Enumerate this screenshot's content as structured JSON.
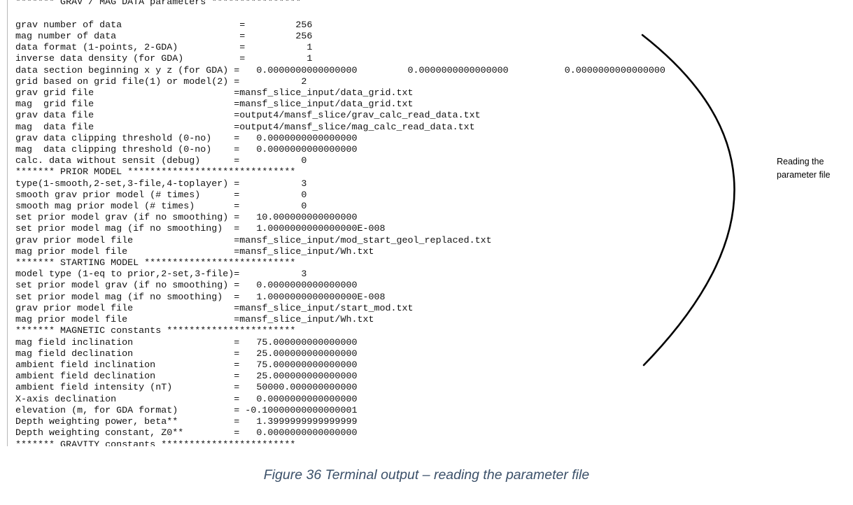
{
  "terminal": {
    "lines": [
      "******* GRAV / MAG DATA parameters ****************",
      "grav number of data                     =         256",
      "mag number of data                      =         256",
      "data format (1-points, 2-GDA)           =           1",
      "inverse data density (for GDA)          =           1",
      "data section beginning x y z (for GDA) =   0.0000000000000000         0.0000000000000000          0.0000000000000000",
      "grid based on grid file(1) or model(2) =           2",
      "grav grid file                         =mansf_slice_input/data_grid.txt",
      "mag  grid file                         =mansf_slice_input/data_grid.txt",
      "grav data file                         =output4/mansf_slice/grav_calc_read_data.txt",
      "mag  data file                         =output4/mansf_slice/mag_calc_read_data.txt",
      "grav data clipping threshold (0-no)    =   0.0000000000000000",
      "mag  data clipping threshold (0-no)    =   0.0000000000000000",
      "calc. data without sensit (debug)      =           0",
      "******* PRIOR MODEL ******************************",
      "type(1-smooth,2-set,3-file,4-toplayer) =           3",
      "smooth grav prior model (# times)      =           0",
      "smooth mag prior model (# times)       =           0",
      "set prior model grav (if no smoothing) =   10.000000000000000",
      "set prior model mag (if no smoothing)  =   1.0000000000000000E-008",
      "grav prior model file                  =mansf_slice_input/mod_start_geol_replaced.txt",
      "mag prior model file                   =mansf_slice_input/Wh.txt",
      "******* STARTING MODEL ***************************",
      "model type (1-eq to prior,2-set,3-file)=           3",
      "set prior model grav (if no smoothing) =   0.0000000000000000",
      "set prior model mag (if no smoothing)  =   1.0000000000000000E-008",
      "grav prior model file                  =mansf_slice_input/start_mod.txt",
      "mag prior model file                   =mansf_slice_input/Wh.txt",
      "******* MAGNETIC constants ***********************",
      "mag field inclination                  =   75.000000000000000",
      "mag field declination                  =   25.000000000000000",
      "ambient field inclination              =   75.000000000000000",
      "ambient field declination              =   25.000000000000000",
      "ambient field intensity (nT)           =   50000.000000000000",
      "X-axis declination                     =   0.0000000000000000",
      "elevation (m, for GDA format)          = -0.10000000000000001",
      "Depth weighting power, beta**          =   1.3999999999999999",
      "Depth weighting constant, Z0**         =   0.0000000000000000",
      "******* GRAVITY constants ************************"
    ]
  },
  "annotation": {
    "line1": "Reading the",
    "line2": "parameter file"
  },
  "caption": "Figure 36 Terminal output – reading the parameter file",
  "colors": {
    "caption": "#3b5069",
    "terminal_text": "#111111"
  }
}
